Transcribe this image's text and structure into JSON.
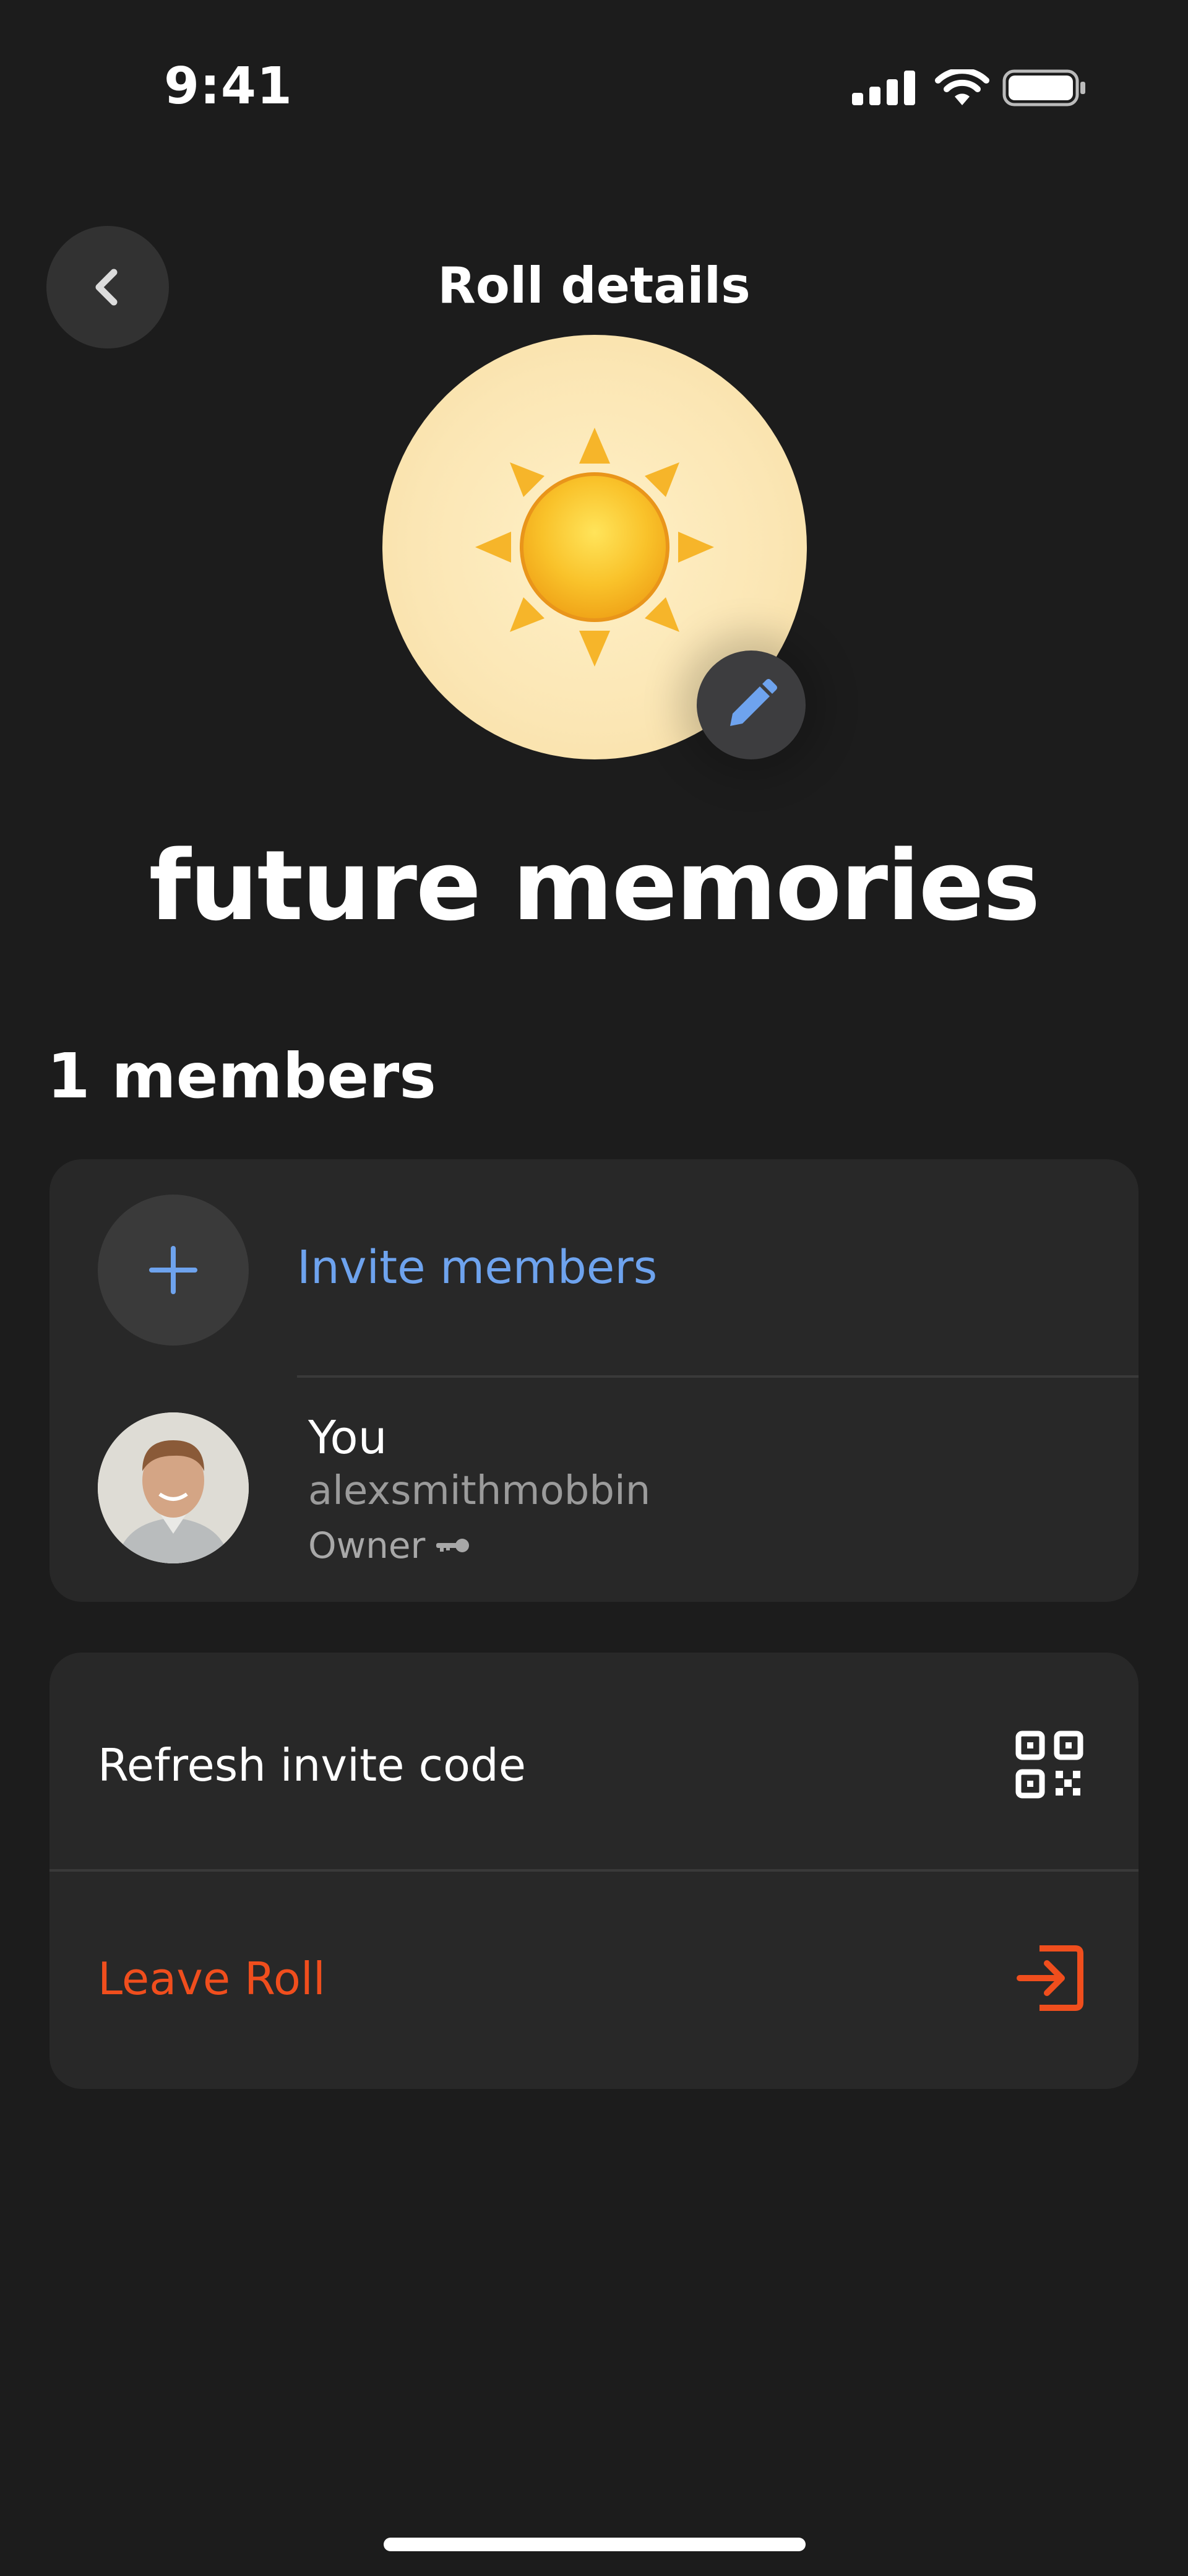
{
  "status_bar": {
    "time": "9:41",
    "icons": [
      "cellular-signal-icon",
      "wifi-icon",
      "battery-icon"
    ]
  },
  "header": {
    "title": "Roll details",
    "back_icon": "chevron-left-icon"
  },
  "roll": {
    "cover_icon": "sun-icon",
    "edit_icon": "pencil-icon",
    "name": "future memories"
  },
  "members": {
    "count_label": "1 members",
    "invite": {
      "label": "Invite members",
      "icon": "plus-icon"
    },
    "list": [
      {
        "name": "You",
        "username": "alexsmithmobbin",
        "role": "Owner",
        "role_icon": "key-icon"
      }
    ]
  },
  "actions": {
    "refresh": {
      "label": "Refresh invite code",
      "icon": "qr-code-icon"
    },
    "leave": {
      "label": "Leave Roll",
      "icon": "exit-icon"
    }
  },
  "colors": {
    "background": "#1c1c1c",
    "card": "#282828",
    "accent_blue": "#6ea3ee",
    "danger": "#f04e1d"
  }
}
